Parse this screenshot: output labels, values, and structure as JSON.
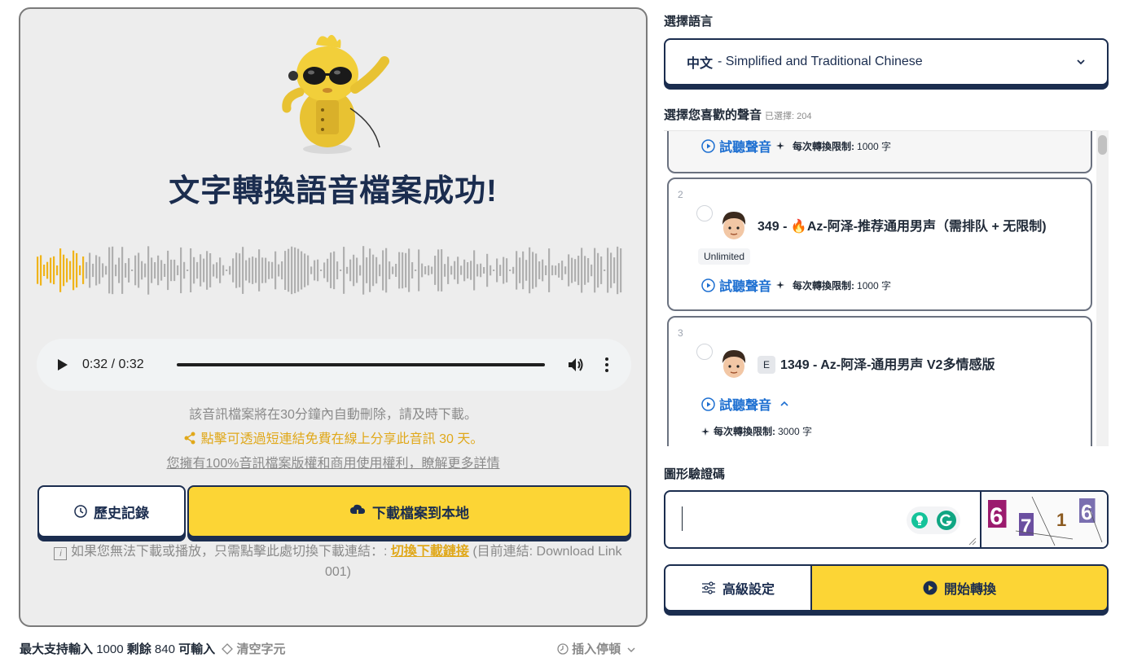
{
  "result": {
    "title": "文字轉換語音檔案成功!",
    "player": {
      "time": "0:32 / 0:32",
      "progress": 1.0
    },
    "waveform": {
      "played_fraction": 0.08
    },
    "notice_delete": "該音訊檔案將在30分鐘內自動刪除，請及時下載。",
    "notice_share": "點擊可透過短連結免費在線上分享此音訊 30 天。",
    "notice_rights": "您擁有100%音訊檔案版權和商用使用權利，瞭解更多詳情",
    "history_label": "歷史記錄",
    "download_label": "下載檔案到本地",
    "fallback_text": "如果您無法下載或播放，只需點擊此處切換下載連結：:",
    "fallback_link": "切換下載鏈接",
    "fallback_current": "(目前連結: Download Link 001)"
  },
  "input_bar": {
    "max_label": "最大支持輸入",
    "max_value": "1000",
    "remain_label": "剩餘",
    "remain_value": "840",
    "remain_suffix": "可輸入",
    "clear_label": "清空字元",
    "insert_pause_label": "插入停頓"
  },
  "language": {
    "label": "選擇語言",
    "selected_main": "中文",
    "selected_detail": "- Simplified and Traditional Chinese"
  },
  "voices": {
    "label": "選擇您喜歡的聲音",
    "selected_label": "已選擇: 204",
    "listen_label": "試聽聲音",
    "limit_label": "每次轉換限制:",
    "items": [
      {
        "limit": "1000 字"
      },
      {
        "num": "2",
        "name": "349 - 🔥Az-阿泽-推荐通用男声（需排队 + 无限制)",
        "tag": "Unlimited",
        "limit": "1000 字"
      },
      {
        "num": "3",
        "badge": "E",
        "name": "1349 - Az-阿泽-通用男声 V2多情感版",
        "limit": "3000 字"
      }
    ]
  },
  "captcha": {
    "label": "圖形驗證碼",
    "code": "6716"
  },
  "actions": {
    "advanced_label": "高級設定",
    "start_label": "開始轉換"
  },
  "colors": {
    "accent_yellow": "#fcd535",
    "navy": "#1b2d4f",
    "link_blue": "#1d6fd1",
    "wave_played": "#f0b41a",
    "wave_unplayed": "#b0b0b0"
  }
}
